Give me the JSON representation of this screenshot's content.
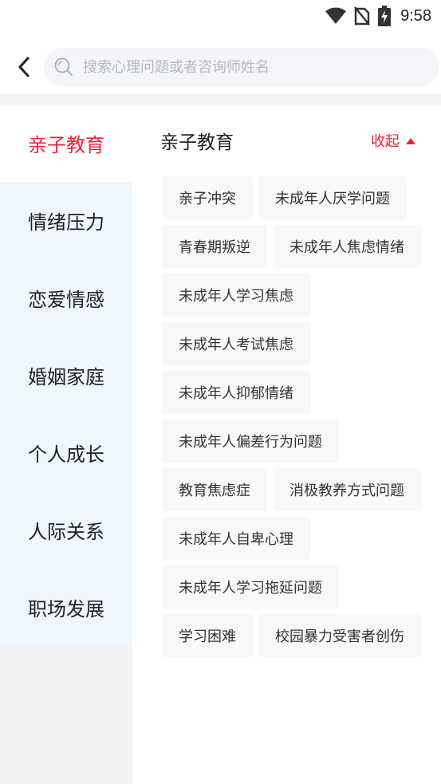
{
  "status_bar": {
    "time": "9:58"
  },
  "search": {
    "placeholder": "搜索心理问题或者咨询师姓名"
  },
  "sidebar": {
    "items": [
      {
        "label": "亲子教育",
        "active": true
      },
      {
        "label": "情绪压力",
        "active": false
      },
      {
        "label": "恋爱情感",
        "active": false
      },
      {
        "label": "婚姻家庭",
        "active": false
      },
      {
        "label": "个人成长",
        "active": false
      },
      {
        "label": "人际关系",
        "active": false
      },
      {
        "label": "职场发展",
        "active": false
      }
    ]
  },
  "content": {
    "title": "亲子教育",
    "collapse_label": "收起",
    "tags": [
      "亲子冲突",
      "未成年人厌学问题",
      "青春期叛逆",
      "未成年人焦虑情绪",
      "未成年人学习焦虑",
      "未成年人考试焦虑",
      "未成年人抑郁情绪",
      "未成年人偏差行为问题",
      "教育焦虑症",
      "消极教养方式问题",
      "未成年人自卑心理",
      "未成年人学习拖延问题",
      "学习困难",
      "校园暴力受害者创伤"
    ]
  },
  "colors": {
    "accent": "#e8253a",
    "sidebar_bg": "#eff6fe",
    "tag_bg": "#f7f8f9"
  }
}
